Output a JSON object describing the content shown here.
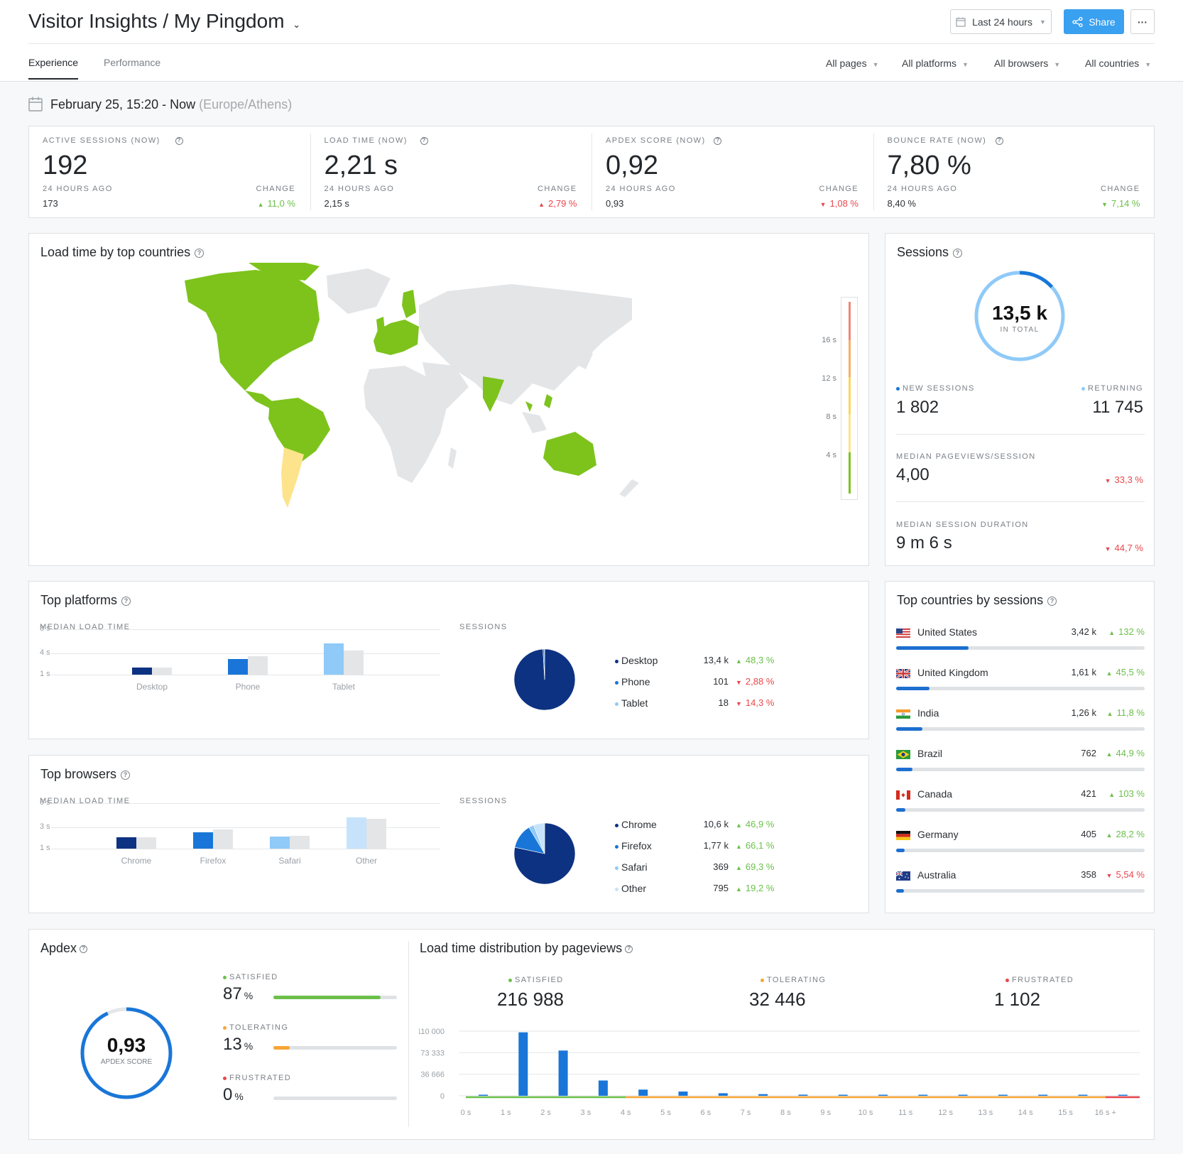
{
  "header": {
    "title": "Visitor Insights / My Pingdom",
    "range": "Last 24 hours",
    "share": "Share",
    "more": "···"
  },
  "tabs": [
    "Experience",
    "Performance"
  ],
  "filters": [
    "All pages",
    "All platforms",
    "All browsers",
    "All countries"
  ],
  "date": {
    "range": "February 25, 15:20 - Now",
    "tz": "(Europe/Athens)"
  },
  "kpis": [
    {
      "label": "ACTIVE SESSIONS (NOW)",
      "value": "192",
      "ago_label": "24 HOURS AGO",
      "ago": "173",
      "change_label": "CHANGE",
      "change": "11,0 %",
      "dir": "up",
      "good": true
    },
    {
      "label": "LOAD TIME (NOW)",
      "value": "2,21 s",
      "ago_label": "24 HOURS AGO",
      "ago": "2,15 s",
      "change_label": "CHANGE",
      "change": "2,79 %",
      "dir": "up",
      "good": false
    },
    {
      "label": "APDEX SCORE (NOW)",
      "value": "0,92",
      "ago_label": "24 HOURS AGO",
      "ago": "0,93",
      "change_label": "CHANGE",
      "change": "1,08 %",
      "dir": "down",
      "good": false
    },
    {
      "label": "BOUNCE RATE (NOW)",
      "value": "7,80 %",
      "ago_label": "24 HOURS AGO",
      "ago": "8,40 %",
      "change_label": "CHANGE",
      "change": "7,14 %",
      "dir": "down",
      "good": true
    }
  ],
  "map": {
    "title": "Load time by top countries",
    "legend": [
      "16 s",
      "12 s",
      "8 s",
      "4 s"
    ],
    "colors": {
      "good": "#7dc31c",
      "mid": "#fde38b",
      "land": "#e3e5e7"
    }
  },
  "sessions": {
    "title": "Sessions",
    "total": "13,5 k",
    "total_label": "IN TOTAL",
    "new_fraction": 0.133,
    "new_label": "NEW SESSIONS",
    "new": "1 802",
    "returning_label": "RETURNING",
    "returning": "11 745",
    "pv_label": "MEDIAN PAGEVIEWS/SESSION",
    "pv": "4,00",
    "pv_change": "33,3 %",
    "dur_label": "MEDIAN SESSION DURATION",
    "dur": "9 m 6 s",
    "dur_change": "44,7 %"
  },
  "platforms": {
    "title": "Top platforms",
    "left_label": "MEDIAN LOAD TIME",
    "right_label": "SESSIONS",
    "ticks": [
      "8 s",
      "4 s",
      "1 s"
    ],
    "items": [
      {
        "name": "Desktop",
        "sessions": "13,4 k",
        "change": "48,3 %",
        "dir": "up",
        "good": true,
        "now": 1.3,
        "prev": 1.3,
        "color": "#0d3282"
      },
      {
        "name": "Phone",
        "sessions": "101",
        "change": "2,88 %",
        "dir": "down",
        "good": false,
        "now": 2.8,
        "prev": 3.2,
        "color": "#1976d8"
      },
      {
        "name": "Tablet",
        "sessions": "18",
        "change": "14,3 %",
        "dir": "down",
        "good": false,
        "now": 5.5,
        "prev": 4.2,
        "color": "#8fcaf8"
      }
    ]
  },
  "browsers": {
    "title": "Top browsers",
    "left_label": "MEDIAN LOAD TIME",
    "right_label": "SESSIONS",
    "ticks": [
      "6 s",
      "3 s",
      "1 s"
    ],
    "items": [
      {
        "name": "Chrome",
        "sessions": "10,6 k",
        "change": "46,9 %",
        "dir": "up",
        "good": true,
        "now": 1.5,
        "prev": 1.5,
        "color": "#0d3282"
      },
      {
        "name": "Firefox",
        "sessions": "1,77 k",
        "change": "66,1 %",
        "dir": "up",
        "good": true,
        "now": 2.2,
        "prev": 2.5,
        "color": "#1976d8"
      },
      {
        "name": "Safari",
        "sessions": "369",
        "change": "69,3 %",
        "dir": "up",
        "good": true,
        "now": 1.6,
        "prev": 1.7,
        "color": "#8fcaf8"
      },
      {
        "name": "Other",
        "sessions": "795",
        "change": "19,2 %",
        "dir": "up",
        "good": true,
        "now": 4.1,
        "prev": 3.9,
        "color": "#c6e3fb"
      }
    ]
  },
  "countries": {
    "title": "Top countries by sessions",
    "items": [
      {
        "name": "United States",
        "sessions": "3,42 k",
        "change": "132 %",
        "dir": "up",
        "good": true,
        "share": 0.29,
        "flag": "us-flag-icon"
      },
      {
        "name": "United Kingdom",
        "sessions": "1,61 k",
        "change": "45,5 %",
        "dir": "up",
        "good": true,
        "share": 0.135,
        "flag": "uk-flag-icon"
      },
      {
        "name": "India",
        "sessions": "1,26 k",
        "change": "11,8 %",
        "dir": "up",
        "good": true,
        "share": 0.107,
        "flag": "in-flag-icon"
      },
      {
        "name": "Brazil",
        "sessions": "762",
        "change": "44,9 %",
        "dir": "up",
        "good": true,
        "share": 0.065,
        "flag": "br-flag-icon"
      },
      {
        "name": "Canada",
        "sessions": "421",
        "change": "103 %",
        "dir": "up",
        "good": true,
        "share": 0.036,
        "flag": "ca-flag-icon"
      },
      {
        "name": "Germany",
        "sessions": "405",
        "change": "28,2 %",
        "dir": "up",
        "good": true,
        "share": 0.034,
        "flag": "de-flag-icon"
      },
      {
        "name": "Australia",
        "sessions": "358",
        "change": "5,54 %",
        "dir": "down",
        "good": false,
        "share": 0.03,
        "flag": "au-flag-icon"
      }
    ]
  },
  "apdex": {
    "title": "Apdex",
    "score": "0,93",
    "score_label": "APDEX SCORE",
    "score_value": 0.93,
    "rows": [
      {
        "label": "SATISFIED",
        "pct": "87",
        "unit": "%",
        "value": 0.87,
        "color": "#6cc04a"
      },
      {
        "label": "TOLERATING",
        "pct": "13",
        "unit": "%",
        "value": 0.13,
        "color": "#f7a535"
      },
      {
        "label": "FRUSTRATED",
        "pct": "0",
        "unit": "%",
        "value": 0.0,
        "color": "#e8474d"
      }
    ]
  },
  "distribution": {
    "title": "Load time distribution by pageviews",
    "summary": [
      {
        "label": "SATISFIED",
        "value": "216 988",
        "color": "#6cc04a"
      },
      {
        "label": "TOLERATING",
        "value": "32 446",
        "color": "#f7a535"
      },
      {
        "label": "FRUSTRATED",
        "value": "1 102",
        "color": "#e8474d"
      }
    ],
    "y_ticks": [
      "110 000",
      "73 333",
      "36 666",
      "0"
    ],
    "y_max": 110000,
    "x_labels": [
      "0 s",
      "1 s",
      "2 s",
      "3 s",
      "4 s",
      "5 s",
      "6 s",
      "7 s",
      "8 s",
      "9 s",
      "10 s",
      "11 s",
      "12 s",
      "13 s",
      "14 s",
      "15 s",
      "16 s +"
    ],
    "values": [
      1200,
      108000,
      77000,
      26000,
      10500,
      7200,
      4300,
      2800,
      1900,
      1300,
      900,
      650,
      500,
      400,
      320,
      250,
      1100
    ]
  }
}
